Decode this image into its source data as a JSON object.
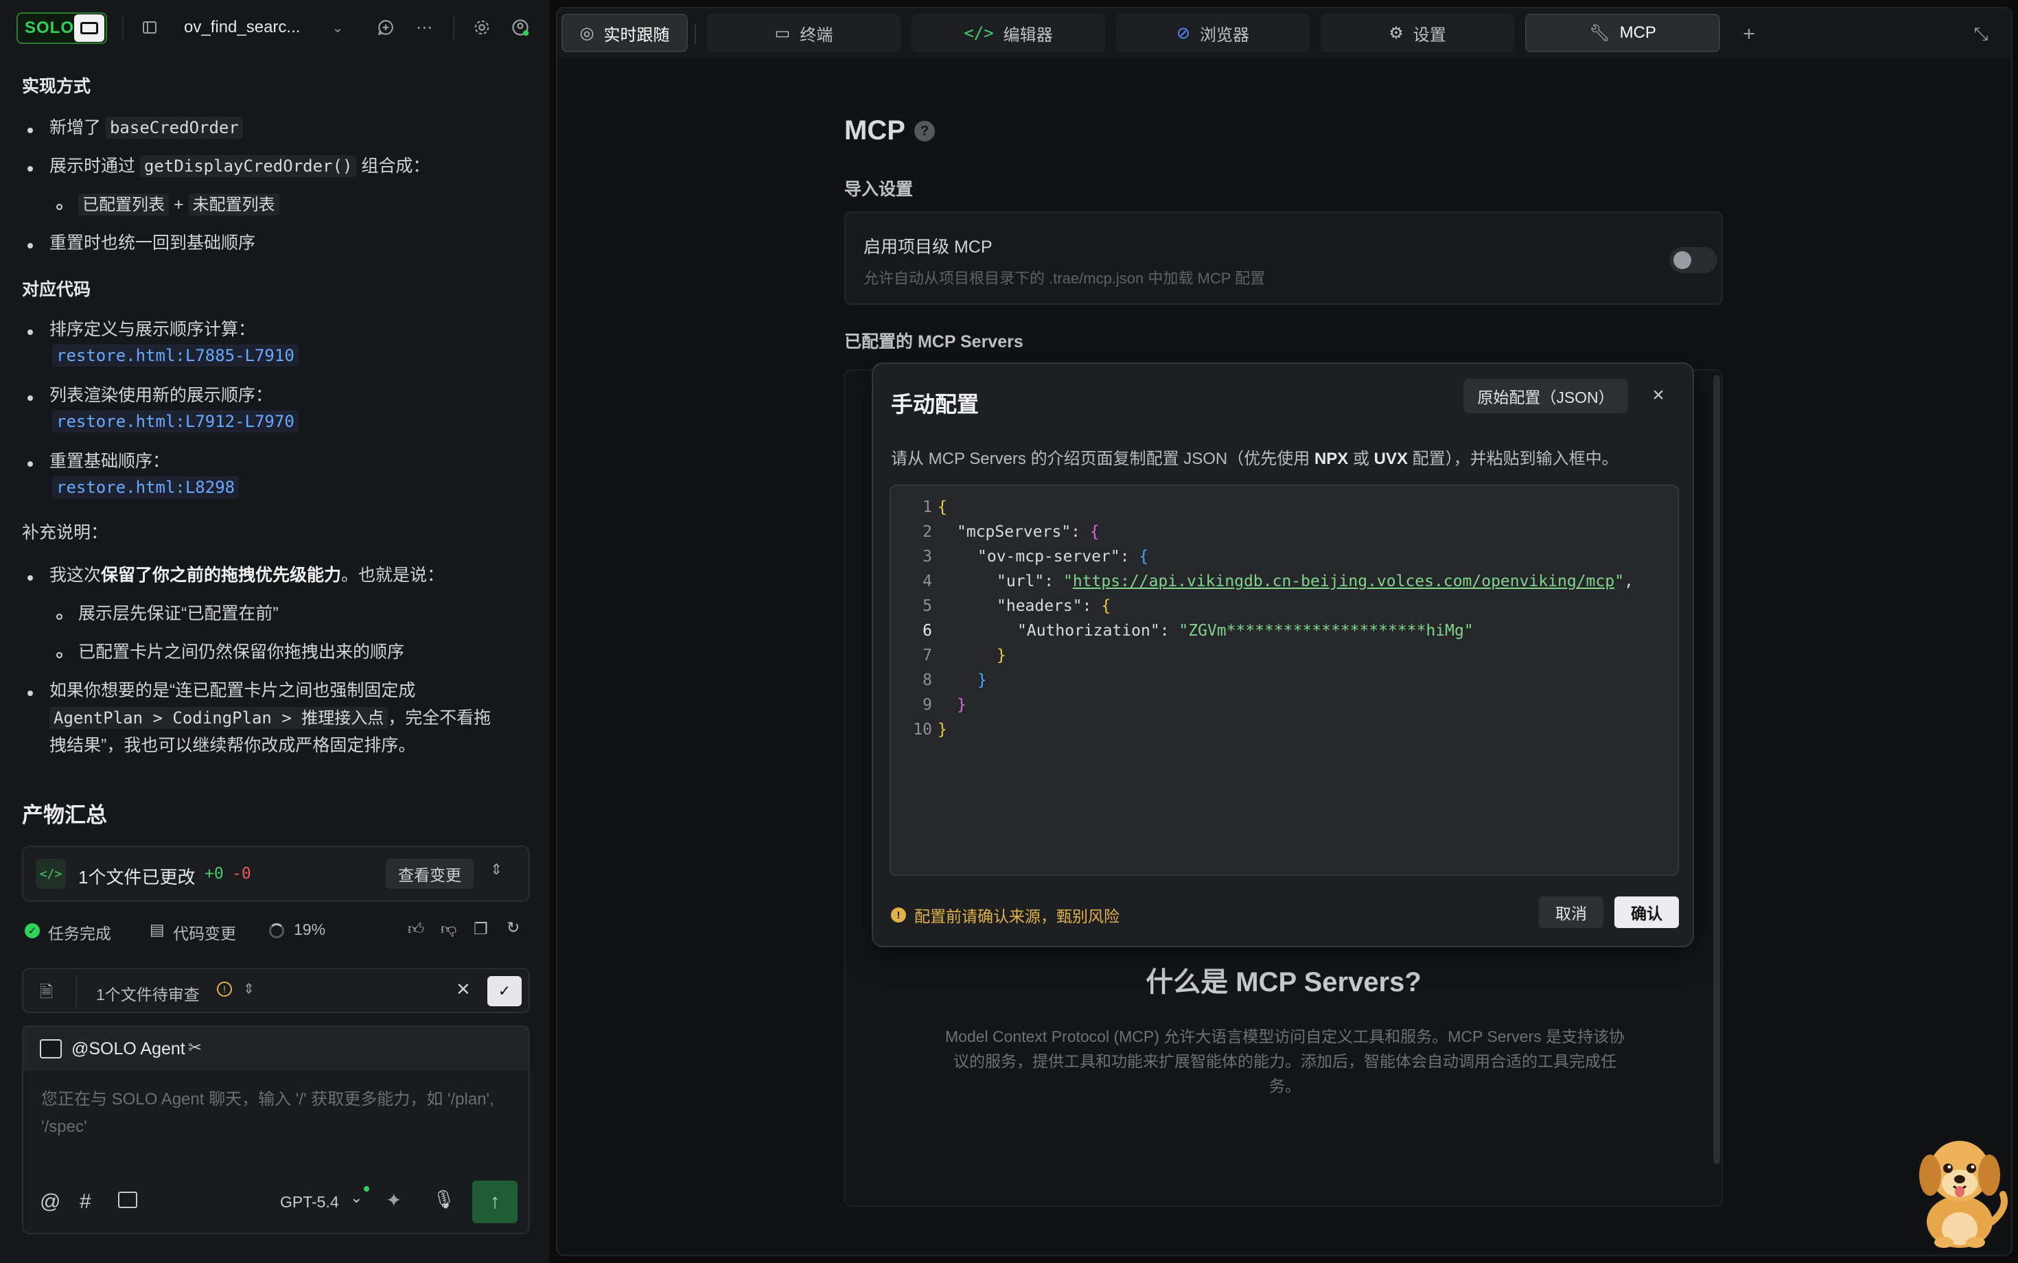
{
  "topbar": {
    "logo_text": "SOLO",
    "project_name": "ov_find_searc..."
  },
  "chat": {
    "h_impl": "实现方式",
    "b1_pre": "新增了",
    "b1_code": "baseCredOrder",
    "b2_pre": "展示时通过",
    "b2_code": "getDisplayCredOrder()",
    "b2_post": "组合成：",
    "b2_sub_a": "已配置列表",
    "b2_sub_plus": "+",
    "b2_sub_b": "未配置列表",
    "b3": "重置时也统一回到基础顺序",
    "h_code": "对应代码",
    "c1_label": "排序定义与展示顺序计算：",
    "c1_link": "restore.html:L7885-L7910",
    "c2_label": "列表渲染使用新的展示顺序：",
    "c2_link": "restore.html:L7912-L7970",
    "c3_label": "重置基础顺序：",
    "c3_link": "restore.html:L8298",
    "h_note": "补充说明：",
    "n1_pre": "我这次",
    "n1_bold": "保留了你之前的拖拽优先级能力",
    "n1_post": "。也就是说：",
    "n1_sub1": "展示层先保证“已配置在前”",
    "n1_sub2": "已配置卡片之间仍然保留你拖拽出来的顺序",
    "n2_line1": "如果你想要的是“连已配置卡片之间也强制固定成",
    "n2_code": "AgentPlan > CodingPlan > 推理接入点",
    "n2_line2_post": "，完全不看拖",
    "n2_line3": "拽结果”，我也可以继续帮你改成严格固定排序。"
  },
  "summary": {
    "title": "产物汇总",
    "files_changed": "1个文件已更改",
    "added": "+0",
    "removed": "-0",
    "view_changes": "查看变更",
    "task_done": "任务完成",
    "code_changes": "代码变更",
    "progress": "19%",
    "pending_review": "1个文件待审查"
  },
  "composer": {
    "agent": "@SOLO Agent",
    "placeholder": "您正在与 SOLO Agent 聊天，输入 '/' 获取更多能力，如 '/plan', '/spec'",
    "model": "GPT-5.4"
  },
  "tabs": [
    {
      "label": "实时跟随",
      "icon": "follow-icon"
    },
    {
      "label": "终端",
      "icon": "terminal-icon"
    },
    {
      "label": "编辑器",
      "icon": "code-icon"
    },
    {
      "label": "浏览器",
      "icon": "compass-icon"
    },
    {
      "label": "设置",
      "icon": "gear-icon"
    },
    {
      "label": "MCP",
      "icon": "wrench-icon"
    }
  ],
  "mcp": {
    "title": "MCP",
    "import_label": "导入设置",
    "project_level_title": "启用项目级 MCP",
    "project_level_desc": "允许自动从项目根目录下的 .trae/mcp.json 中加载 MCP 配置",
    "configured_label": "已配置的 MCP Servers",
    "what_title": "什么是 MCP Servers?",
    "what_desc": "Model Context Protocol (MCP) 允许大语言模型访问自定义工具和服务。MCP Servers 是支持该协议的服务，提供工具和功能来扩展智能体的能力。添加后，智能体会自动调用合适的工具完成任务。"
  },
  "modal": {
    "title": "手动配置",
    "raw_button": "原始配置（JSON）",
    "desc_pre": "请从 MCP Servers 的介绍页面复制配置 JSON（优先使用 ",
    "desc_npx": "NPX",
    "desc_or": " 或 ",
    "desc_uvx": "UVX",
    "desc_post": " 配置），并粘贴到输入框中。",
    "line_numbers": [
      "1",
      "2",
      "3",
      "4",
      "5",
      "6",
      "7",
      "8",
      "9",
      "10"
    ],
    "key_mcpServers": "\"mcpServers\"",
    "key_server": "\"ov-mcp-server\"",
    "key_url": "\"url\"",
    "url_value": "https://api.vikingdb.cn-beijing.volces.com/openviking/mcp",
    "key_headers": "\"headers\"",
    "key_auth": "\"Authorization\"",
    "auth_value": "\"ZGVm*********************hiMg\"",
    "warning": "配置前请确认来源，甄别风险",
    "cancel": "取消",
    "confirm": "确认"
  }
}
